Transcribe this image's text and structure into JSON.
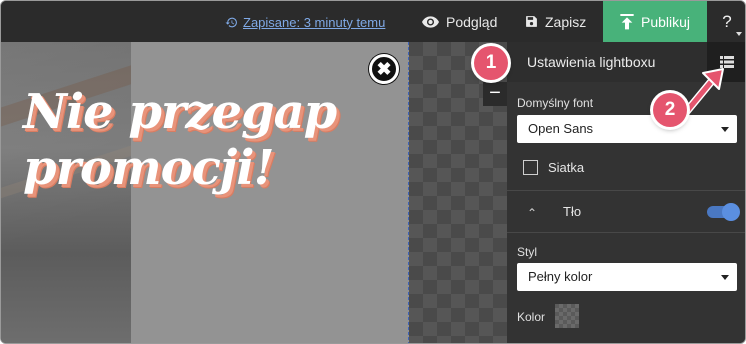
{
  "topbar": {
    "saved_label": "Zapisane: 3 minuty temu",
    "preview_label": "Podgląd",
    "save_label": "Zapisz",
    "publish_label": "Publikuj",
    "help_label": "?"
  },
  "canvas": {
    "headline_line1": "Nie przegap",
    "headline_line2": "promocji!",
    "close_symbol": "✖",
    "zoom_out_symbol": "−"
  },
  "panel": {
    "title": "Ustawienia lightboxu",
    "font_label": "Domyślny font",
    "font_value": "Open Sans",
    "grid_label": "Siatka",
    "grid_checked": false,
    "background_label": "Tło",
    "background_enabled": true,
    "style_label": "Styl",
    "style_value": "Pełny kolor",
    "color_label": "Kolor"
  },
  "callouts": {
    "badge1": "1",
    "badge2": "2"
  },
  "colors": {
    "publish": "#48b27a",
    "badge": "#e5556e",
    "link": "#7fa9e6",
    "toggle": "#5b8fe0",
    "headline_shadow": "#e8937a"
  },
  "icons": {
    "saved": "history-icon",
    "preview": "eye-icon",
    "save": "floppy-disk-icon",
    "publish": "upload-icon",
    "panel_menu": "list-icon",
    "collapse": "chevron-up-icon"
  }
}
